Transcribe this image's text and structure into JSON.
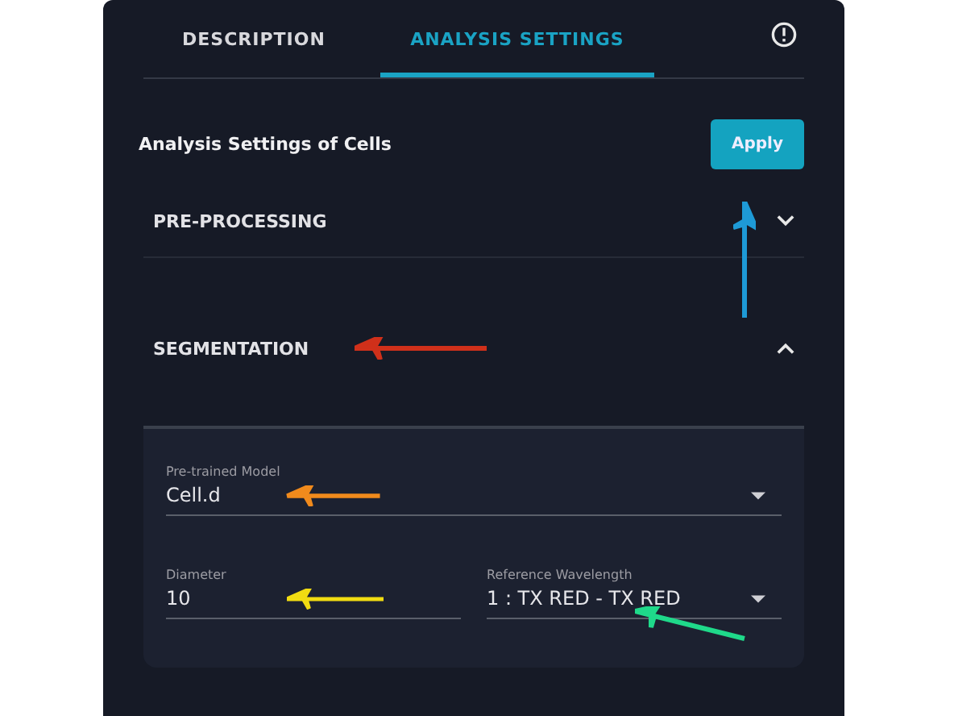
{
  "tabs": [
    {
      "label": "DESCRIPTION",
      "selected": false
    },
    {
      "label": "ANALYSIS SETTINGS",
      "selected": true
    }
  ],
  "header": {
    "title": "Analysis Settings of Cells",
    "apply_button": "Apply"
  },
  "sections": [
    {
      "title": "PRE-PROCESSING",
      "expanded": false
    },
    {
      "title": "SEGMENTATION",
      "expanded": true
    }
  ],
  "segmentation_fields": {
    "model": {
      "label": "Pre-trained Model",
      "value": "Cell.d"
    },
    "diameter": {
      "label": "Diameter",
      "value": "10"
    },
    "wavelength": {
      "label": "Reference Wavelength",
      "value": "1 : TX RED - TX RED"
    }
  }
}
